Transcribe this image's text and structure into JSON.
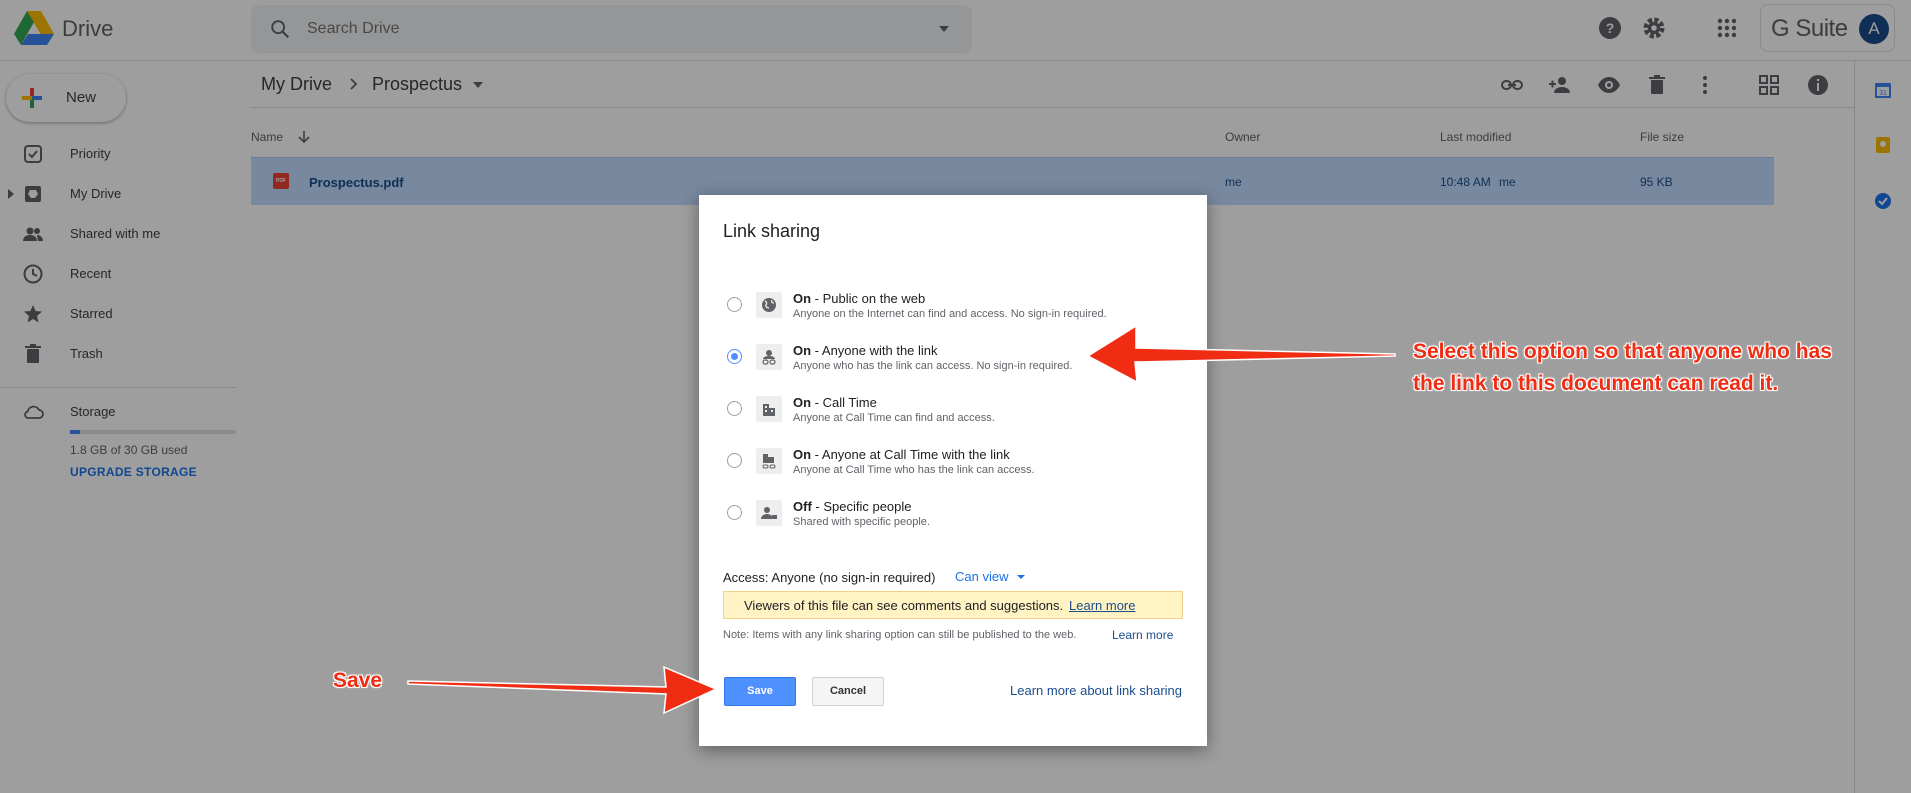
{
  "app": {
    "title": "Drive"
  },
  "search": {
    "placeholder": "Search Drive"
  },
  "header": {
    "brand": "G Suite",
    "avatar_letter": "A"
  },
  "sidebar": {
    "new_label": "New",
    "items": [
      {
        "label": "Priority",
        "icon": "priority-icon"
      },
      {
        "label": "My Drive",
        "icon": "my-drive-icon"
      },
      {
        "label": "Shared with me",
        "icon": "shared-icon"
      },
      {
        "label": "Recent",
        "icon": "clock-icon"
      },
      {
        "label": "Starred",
        "icon": "star-icon"
      },
      {
        "label": "Trash",
        "icon": "trash-icon"
      }
    ],
    "storage": {
      "label": "Storage",
      "used_text": "1.8 GB of 30 GB used",
      "used_fraction": 0.06,
      "upgrade_label": "UPGRADE STORAGE"
    }
  },
  "breadcrumb": {
    "root": "My Drive",
    "current": "Prospectus"
  },
  "table": {
    "columns": [
      "Name",
      "Owner",
      "Last modified",
      "File size"
    ],
    "rows": [
      {
        "name": "Prospectus.pdf",
        "owner": "me",
        "modified": "10:48 AM",
        "modified_by": "me",
        "size": "95 KB",
        "type_badge": "PDF"
      }
    ]
  },
  "dialog": {
    "title": "Link sharing",
    "options": [
      {
        "state": "On",
        "title": " - Public on the web",
        "desc": "Anyone on the Internet can find and access. No sign-in required.",
        "selected": false,
        "icon": "globe-icon"
      },
      {
        "state": "On",
        "title": " - Anyone with the link",
        "desc": "Anyone who has the link can access. No sign-in required.",
        "selected": true,
        "icon": "link-person-icon"
      },
      {
        "state": "On",
        "title": " - Call Time",
        "desc": "Anyone at Call Time can find and access.",
        "selected": false,
        "icon": "building-icon"
      },
      {
        "state": "On",
        "title": " - Anyone at Call Time with the link",
        "desc": "Anyone at Call Time who has the link can access.",
        "selected": false,
        "icon": "building-link-icon"
      },
      {
        "state": "Off",
        "title": " - Specific people",
        "desc": "Shared with specific people.",
        "selected": false,
        "icon": "person-lock-icon"
      }
    ],
    "access_label": "Access:  Anyone (no sign-in required)",
    "access_level": "Can view",
    "notice_text": "Viewers of this file can see comments and suggestions.",
    "notice_link": "Learn more",
    "note_text": "Note: Items with any link sharing option can still be published to the web.",
    "note_link": "Learn more",
    "save_label": "Save",
    "cancel_label": "Cancel",
    "learn_sharing": "Learn more about link sharing"
  },
  "annotations": {
    "option_note": "Select this option so that anyone who has the link to this document can read it.",
    "option_note_line1": "Select this option so that anyone who has",
    "option_note_line2": "the link to this document can read it.",
    "save_note": "Save",
    "color": "#f02c12"
  },
  "colors": {
    "accent": "#4d90fe",
    "selection": "#c2dbff",
    "link": "#1a4d8c"
  }
}
